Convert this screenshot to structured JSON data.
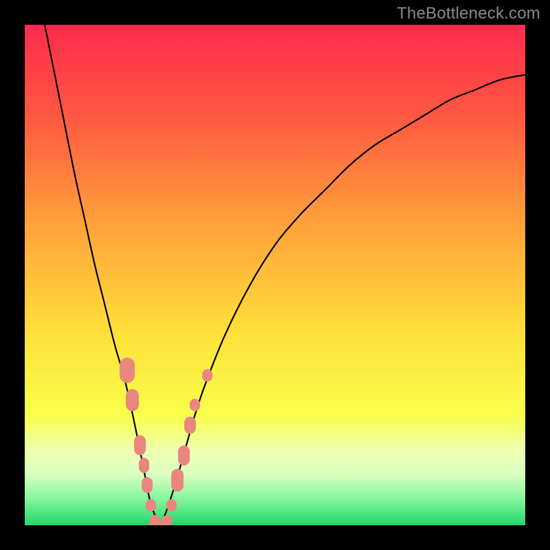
{
  "watermark": "TheBottleneck.com",
  "chart_data": {
    "type": "line",
    "title": "",
    "xlabel": "",
    "ylabel": "",
    "xlim": [
      0,
      100
    ],
    "ylim": [
      0,
      100
    ],
    "gradient_stops": [
      {
        "offset": 0,
        "color": "#ff2a4d"
      },
      {
        "offset": 0.18,
        "color": "#ff5742"
      },
      {
        "offset": 0.4,
        "color": "#ffa23a"
      },
      {
        "offset": 0.62,
        "color": "#ffe13a"
      },
      {
        "offset": 0.78,
        "color": "#f9ff4a"
      },
      {
        "offset": 0.85,
        "color": "#efffb0"
      },
      {
        "offset": 0.9,
        "color": "#d8ffc0"
      },
      {
        "offset": 0.95,
        "color": "#7ff59a"
      },
      {
        "offset": 1.0,
        "color": "#24d66a"
      }
    ],
    "series": [
      {
        "name": "bottleneck-curve",
        "x": [
          4,
          6,
          8,
          10,
          12,
          14,
          16,
          18,
          20,
          22,
          24,
          25,
          26,
          27,
          28,
          30,
          32,
          34,
          36,
          40,
          45,
          50,
          55,
          60,
          65,
          70,
          75,
          80,
          85,
          90,
          95,
          100
        ],
        "y": [
          100,
          90,
          80,
          70,
          61,
          52,
          44,
          36,
          29,
          20,
          10,
          5,
          2,
          0,
          2,
          8,
          15,
          22,
          28,
          38,
          48,
          56,
          62,
          67,
          72,
          76,
          79,
          82,
          85,
          87,
          89,
          90
        ]
      }
    ],
    "markers": [
      {
        "x": 20.5,
        "y": 31,
        "w": 3.0,
        "h": 5.0,
        "shape": "pill"
      },
      {
        "x": 21.5,
        "y": 25,
        "w": 2.5,
        "h": 4.5,
        "shape": "pill"
      },
      {
        "x": 23.0,
        "y": 16,
        "w": 2.3,
        "h": 4.0,
        "shape": "pill"
      },
      {
        "x": 23.8,
        "y": 12,
        "w": 2.0,
        "h": 3.0,
        "shape": "round"
      },
      {
        "x": 24.5,
        "y": 8,
        "w": 2.2,
        "h": 3.2,
        "shape": "round"
      },
      {
        "x": 25.2,
        "y": 4,
        "w": 2.0,
        "h": 2.5,
        "shape": "round"
      },
      {
        "x": 26.0,
        "y": 1,
        "w": 2.0,
        "h": 2.0,
        "shape": "round"
      },
      {
        "x": 27.0,
        "y": 0,
        "w": 4.5,
        "h": 2.0,
        "shape": "pill"
      },
      {
        "x": 28.5,
        "y": 1,
        "w": 2.0,
        "h": 2.0,
        "shape": "round"
      },
      {
        "x": 29.3,
        "y": 4,
        "w": 2.0,
        "h": 2.5,
        "shape": "round"
      },
      {
        "x": 30.5,
        "y": 9,
        "w": 2.5,
        "h": 4.5,
        "shape": "pill"
      },
      {
        "x": 31.8,
        "y": 14,
        "w": 2.3,
        "h": 4.0,
        "shape": "pill"
      },
      {
        "x": 33.0,
        "y": 20,
        "w": 2.3,
        "h": 3.5,
        "shape": "pill"
      },
      {
        "x": 34.0,
        "y": 24,
        "w": 2.0,
        "h": 2.5,
        "shape": "round"
      },
      {
        "x": 36.5,
        "y": 30,
        "w": 2.0,
        "h": 2.5,
        "shape": "round"
      }
    ]
  }
}
